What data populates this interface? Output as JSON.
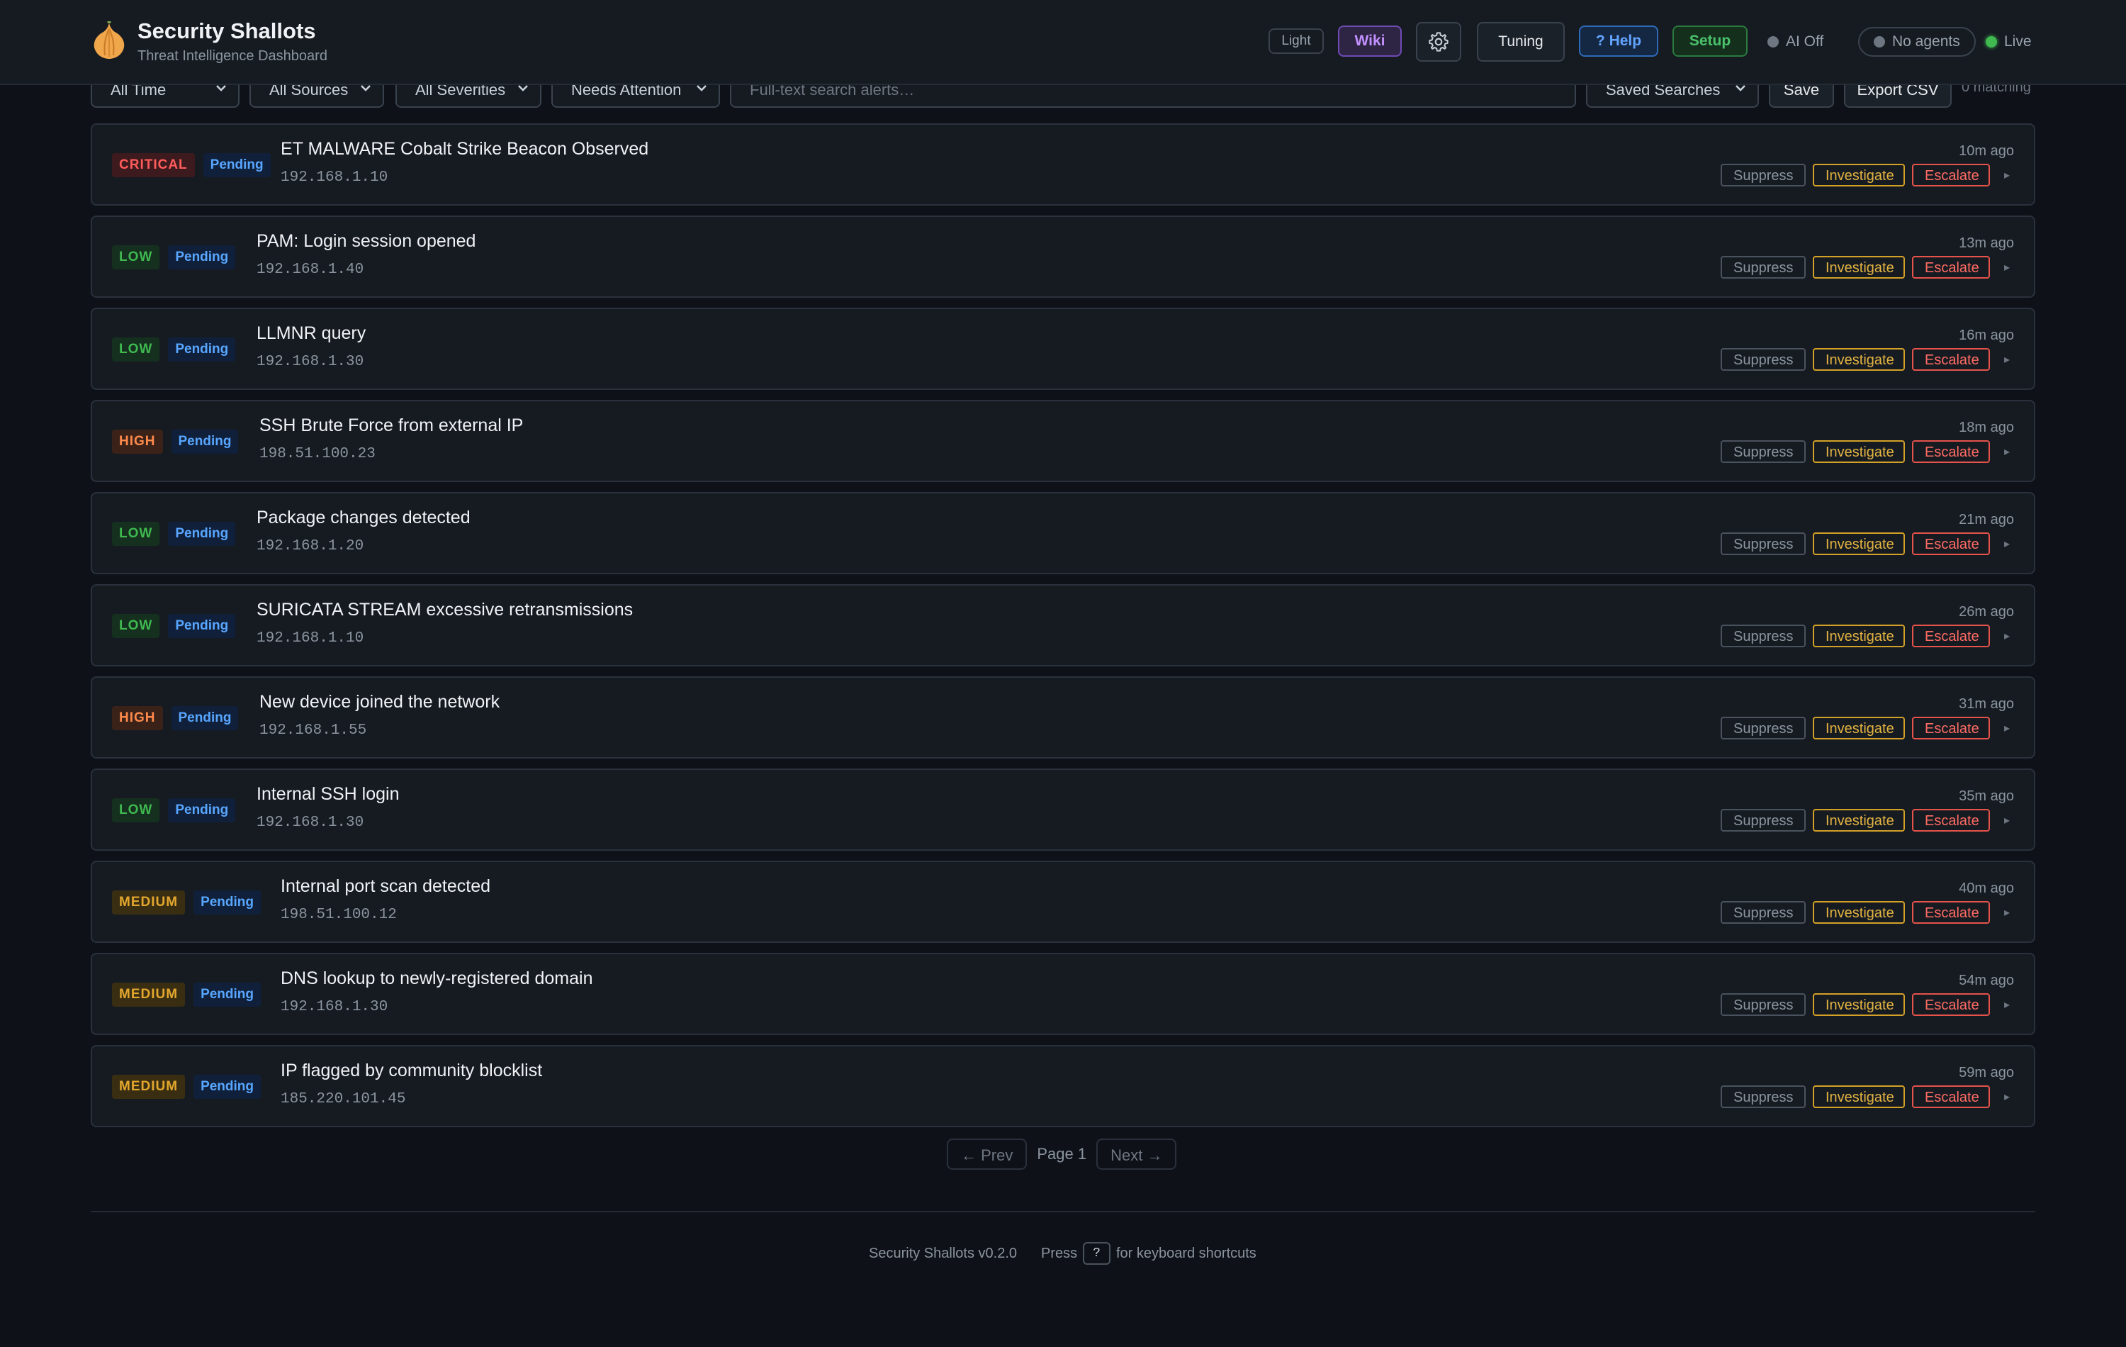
{
  "header": {
    "title": "Security Shallots",
    "subtitle": "Threat Intelligence Dashboard",
    "logo_icon": "onion-icon",
    "buttons": {
      "theme": "Light",
      "wiki": "Wiki",
      "tuning": "Tuning",
      "help": "? Help",
      "setup": "Setup"
    },
    "status": {
      "ai": "AI Off",
      "agents": "No agents",
      "live": "Live"
    },
    "colors": {
      "wiki": "#c391ff",
      "help": "#63a4ff",
      "setup": "#4ac26b",
      "live_dot": "#3fb950"
    }
  },
  "filters": {
    "time": "All Time",
    "sources": "All Sources",
    "severities": "All Severities",
    "attention": "Needs Attention",
    "search_placeholder": "Full-text search alerts…",
    "saved_searches": "Saved Searches",
    "save_label": "Save",
    "export_label": "Export CSV",
    "matching": "0 matching"
  },
  "alerts": [
    {
      "severity": "CRITICAL",
      "status": "Pending",
      "title": "ET MALWARE Cobalt Strike Beacon Observed",
      "ip": "192.168.1.10",
      "time": "10m ago"
    },
    {
      "severity": "LOW",
      "status": "Pending",
      "title": "PAM: Login session opened",
      "ip": "192.168.1.40",
      "time": "13m ago"
    },
    {
      "severity": "LOW",
      "status": "Pending",
      "title": "LLMNR query",
      "ip": "192.168.1.30",
      "time": "16m ago"
    },
    {
      "severity": "HIGH",
      "status": "Pending",
      "title": "SSH Brute Force from external IP",
      "ip": "198.51.100.23",
      "time": "18m ago"
    },
    {
      "severity": "LOW",
      "status": "Pending",
      "title": "Package changes detected",
      "ip": "192.168.1.20",
      "time": "21m ago"
    },
    {
      "severity": "LOW",
      "status": "Pending",
      "title": "SURICATA STREAM excessive retransmissions",
      "ip": "192.168.1.10",
      "time": "26m ago"
    },
    {
      "severity": "HIGH",
      "status": "Pending",
      "title": "New device joined the network",
      "ip": "192.168.1.55",
      "time": "31m ago"
    },
    {
      "severity": "LOW",
      "status": "Pending",
      "title": "Internal SSH login",
      "ip": "192.168.1.30",
      "time": "35m ago"
    },
    {
      "severity": "MEDIUM",
      "status": "Pending",
      "title": "Internal port scan detected",
      "ip": "198.51.100.12",
      "time": "40m ago"
    },
    {
      "severity": "MEDIUM",
      "status": "Pending",
      "title": "DNS lookup to newly-registered domain",
      "ip": "192.168.1.30",
      "time": "54m ago"
    },
    {
      "severity": "MEDIUM",
      "status": "Pending",
      "title": "IP flagged by community blocklist",
      "ip": "185.220.101.45",
      "time": "59m ago"
    }
  ],
  "alert_actions": {
    "suppress": "Suppress",
    "investigate": "Investigate",
    "escalate": "Escalate",
    "expand_icon": "▸"
  },
  "severity_colors": {
    "CRITICAL": "#ff5c5c",
    "HIGH": "#ff8a4c",
    "MEDIUM": "#e3a72e",
    "LOW": "#3fb950"
  },
  "pagination": {
    "prev": "← Prev",
    "page": "Page 1",
    "next": "Next →"
  },
  "footer": {
    "version": "Security Shallots v0.2.0",
    "press": "Press",
    "key": "?",
    "shortcuts": "for keyboard shortcuts"
  }
}
